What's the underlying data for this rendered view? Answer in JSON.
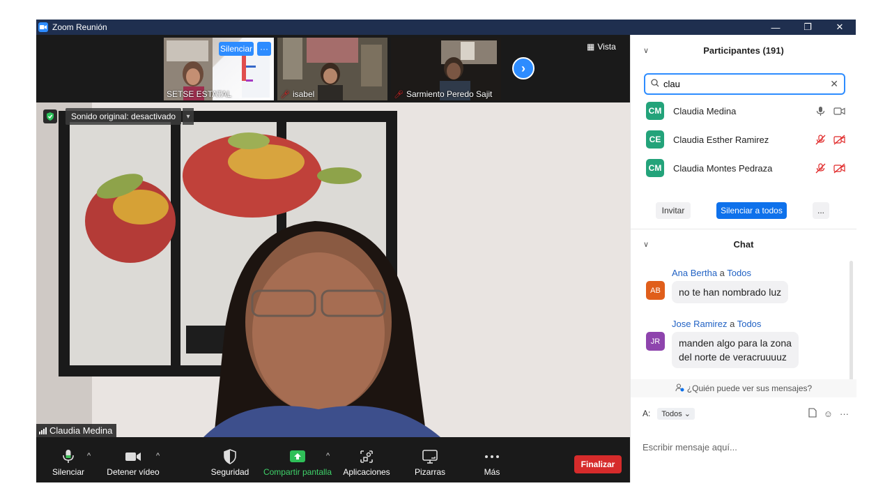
{
  "window": {
    "title": "Zoom Reunión",
    "minimize": "—",
    "restore": "❐",
    "close": "✕"
  },
  "strip": {
    "thumbs": [
      {
        "name": "SETSE ESTATAL",
        "muted": false
      },
      {
        "name": "isabel",
        "muted": true
      },
      {
        "name": "Sarmiento Peredo Sajit",
        "muted": true
      }
    ],
    "silence_label": "Silenciar",
    "more_label": "···",
    "view_label": "Vista"
  },
  "main": {
    "sound_label": "Sonido original: desactivado",
    "speaker": "Claudia Medina"
  },
  "toolbar": {
    "mute": "Silenciar",
    "video": "Detener vídeo",
    "security": "Seguridad",
    "share": "Compartir pantalla",
    "apps": "Aplicaciones",
    "whiteboards": "Pizarras",
    "more": "Más",
    "end": "Finalizar"
  },
  "participants": {
    "title": "Participantes (191)",
    "search_value": "clau",
    "items": [
      {
        "initials": "CM",
        "name": "Claudia Medina",
        "color": "#23a37a",
        "muted": false
      },
      {
        "initials": "CE",
        "name": "Claudia Esther Ramirez",
        "color": "#23a37a",
        "muted": true
      },
      {
        "initials": "CM",
        "name": "Claudia Montes Pedraza",
        "color": "#23a37a",
        "muted": true
      }
    ],
    "invite": "Invitar",
    "mute_all": "Silenciar a todos",
    "more": "..."
  },
  "chat": {
    "title": "Chat",
    "messages": [
      {
        "initials": "AB",
        "color": "#e05e1b",
        "sender": "Ana Bertha",
        "connector": "a",
        "to": "Todos",
        "text": "no  te han nombrado luz"
      },
      {
        "initials": "JR",
        "color": "#8e44ad",
        "sender": "Jose Ramirez",
        "connector": "a",
        "to": "Todos",
        "text_line1": "manden algo para la zona",
        "text_line2": "del norte de veracruuuuz"
      }
    ],
    "who_can_see": "¿Quién puede ver sus mensajes?",
    "to_label": "A:",
    "to_value": "Todos",
    "placeholder": "Escribir mensaje aquí..."
  }
}
